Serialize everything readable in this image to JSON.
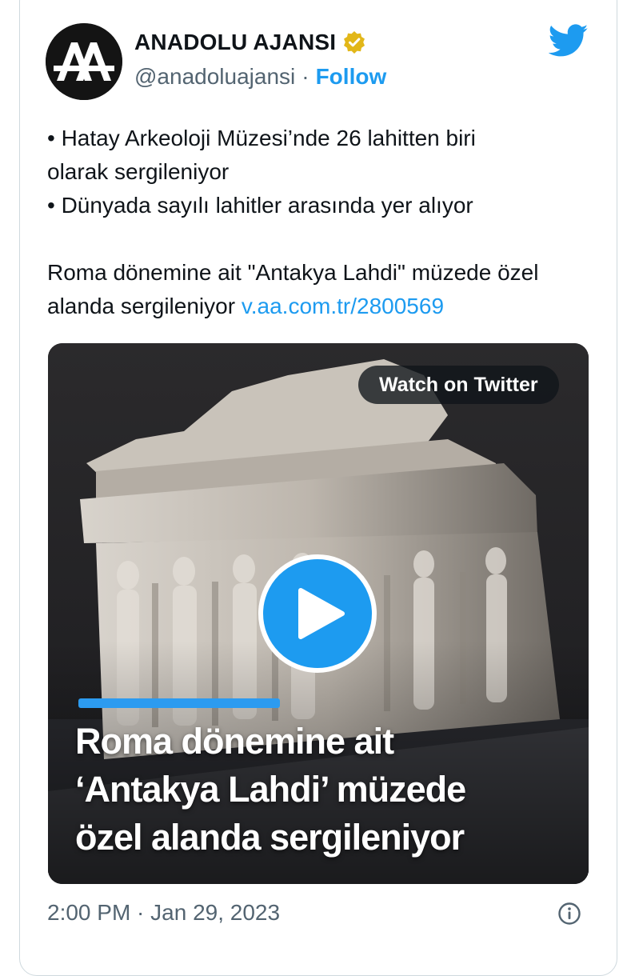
{
  "account": {
    "name": "ANADOLU AJANSI",
    "handle": "@anadoluajansi",
    "separator": "·",
    "follow_label": "Follow",
    "avatar_icon": "aa-logo-icon",
    "verified_icon": "gold-verified-badge-icon"
  },
  "platform_icon": "twitter-bird-icon",
  "tweet": {
    "lines": [
      "• Hatay Arkeoloji Müzesi’nde 26 lahitten biri",
      "olarak sergileniyor",
      "• Dünyada sayılı lahitler arasında yer alıyor"
    ],
    "paragraph_line1": "Roma dönemine ait \"Antakya Lahdi\" müzede özel",
    "paragraph_line2": "alanda sergileniyor",
    "link": "v.aa.com.tr/2800569"
  },
  "media": {
    "watch_label": "Watch on Twitter",
    "play_icon": "play-icon",
    "caption_lines": [
      "Roma dönemine ait",
      "‘Antakya Lahdi’ müzede",
      "özel alanda sergileniyor"
    ]
  },
  "footer": {
    "timestamp": "2:00 PM · Jan 29, 2023",
    "info_icon": "info-icon"
  },
  "colors": {
    "accent": "#1d9bf0",
    "text": "#0f1419",
    "muted": "#536471",
    "verified_gold": "#e2b719",
    "border": "#cfd9de"
  }
}
